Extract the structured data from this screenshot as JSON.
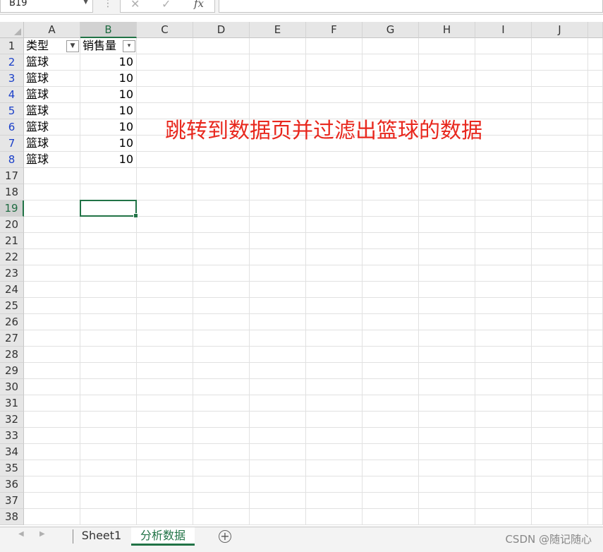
{
  "formula_bar": {
    "name_box": "B19",
    "cancel_icon": "✕",
    "enter_icon": "✓",
    "fx_label": "fx",
    "formula": ""
  },
  "columns": [
    "A",
    "B",
    "C",
    "D",
    "E",
    "F",
    "G",
    "H",
    "I",
    "J"
  ],
  "selected_column": "B",
  "rows": [
    "1",
    "2",
    "3",
    "4",
    "5",
    "6",
    "7",
    "8",
    "17",
    "18",
    "19",
    "20",
    "21",
    "22",
    "23",
    "24",
    "25",
    "26",
    "27",
    "28",
    "29",
    "30",
    "31",
    "32",
    "33",
    "34",
    "35",
    "36",
    "37",
    "38"
  ],
  "filtered_rows": [
    "2",
    "3",
    "4",
    "5",
    "6",
    "7",
    "8"
  ],
  "selected_row": "19",
  "header_row": {
    "a": "类型",
    "b": "销售量"
  },
  "data_rows": [
    {
      "type": "篮球",
      "sales": "10"
    },
    {
      "type": "篮球",
      "sales": "10"
    },
    {
      "type": "篮球",
      "sales": "10"
    },
    {
      "type": "篮球",
      "sales": "10"
    },
    {
      "type": "篮球",
      "sales": "10"
    },
    {
      "type": "篮球",
      "sales": "10"
    },
    {
      "type": "篮球",
      "sales": "10"
    }
  ],
  "annotation": "跳转到数据页并过滤出篮球的数据",
  "tabs": {
    "nav_prev": "◀",
    "nav_next": "▶",
    "sheets": [
      "Sheet1",
      "分析数据"
    ],
    "active_sheet": "分析数据",
    "add_symbol": "+"
  },
  "watermark": "CSDN @随记随心",
  "colors": {
    "accent": "#217346",
    "annotation": "#e8281e",
    "filtered_row_number": "#1a3fc9"
  }
}
